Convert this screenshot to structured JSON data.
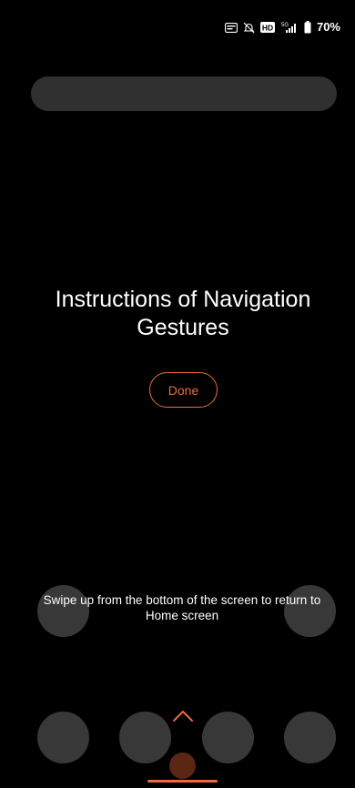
{
  "status_bar": {
    "battery_percent": "70%",
    "icons": [
      "vowifi-icon",
      "mute-icon",
      "hd-icon",
      "signal-5g-icon",
      "battery-icon"
    ],
    "hd_label": "HD",
    "network_label": "5G"
  },
  "search": {
    "placeholder": ""
  },
  "tutorial": {
    "title": "Instructions of Navigation Gestures",
    "done_label": "Done",
    "instruction": "Swipe up from the bottom of the screen to return to Home screen"
  },
  "colors": {
    "accent": "#ec6a3c",
    "background": "#000000",
    "circle": "#383838",
    "pill": "#303030"
  }
}
